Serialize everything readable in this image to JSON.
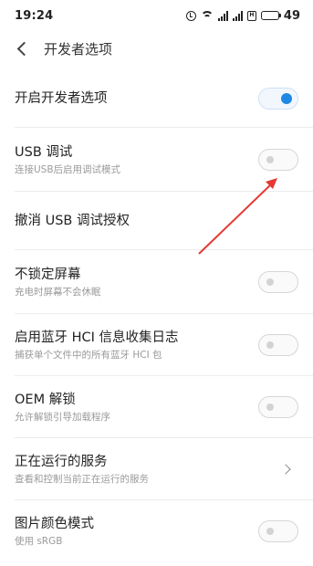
{
  "status_bar": {
    "time": "19:24",
    "sim_label": "H",
    "battery_level": "49"
  },
  "header": {
    "title": "开发者选项"
  },
  "items": [
    {
      "title": "开启开发者选项",
      "subtitle": "",
      "control": "toggle",
      "on": true
    },
    {
      "title": "USB 调试",
      "subtitle": "连接USB后启用调试模式",
      "control": "toggle",
      "on": false
    },
    {
      "title": "撤消 USB 调试授权",
      "subtitle": "",
      "control": "none"
    },
    {
      "title": "不锁定屏幕",
      "subtitle": "充电时屏幕不会休眠",
      "control": "toggle",
      "on": false
    },
    {
      "title": "启用蓝牙 HCI 信息收集日志",
      "subtitle": "捕获单个文件中的所有蓝牙 HCI 包",
      "control": "toggle",
      "on": false
    },
    {
      "title": "OEM 解锁",
      "subtitle": "允许解锁引导加载程序",
      "control": "toggle",
      "on": false
    },
    {
      "title": "正在运行的服务",
      "subtitle": "查看和控制当前正在运行的服务",
      "control": "chevron"
    },
    {
      "title": "图片颜色模式",
      "subtitle": "使用 sRGB",
      "control": "toggle",
      "on": false
    }
  ],
  "colors": {
    "accent": "#1e88e5",
    "annotation_arrow": "#e53935"
  }
}
